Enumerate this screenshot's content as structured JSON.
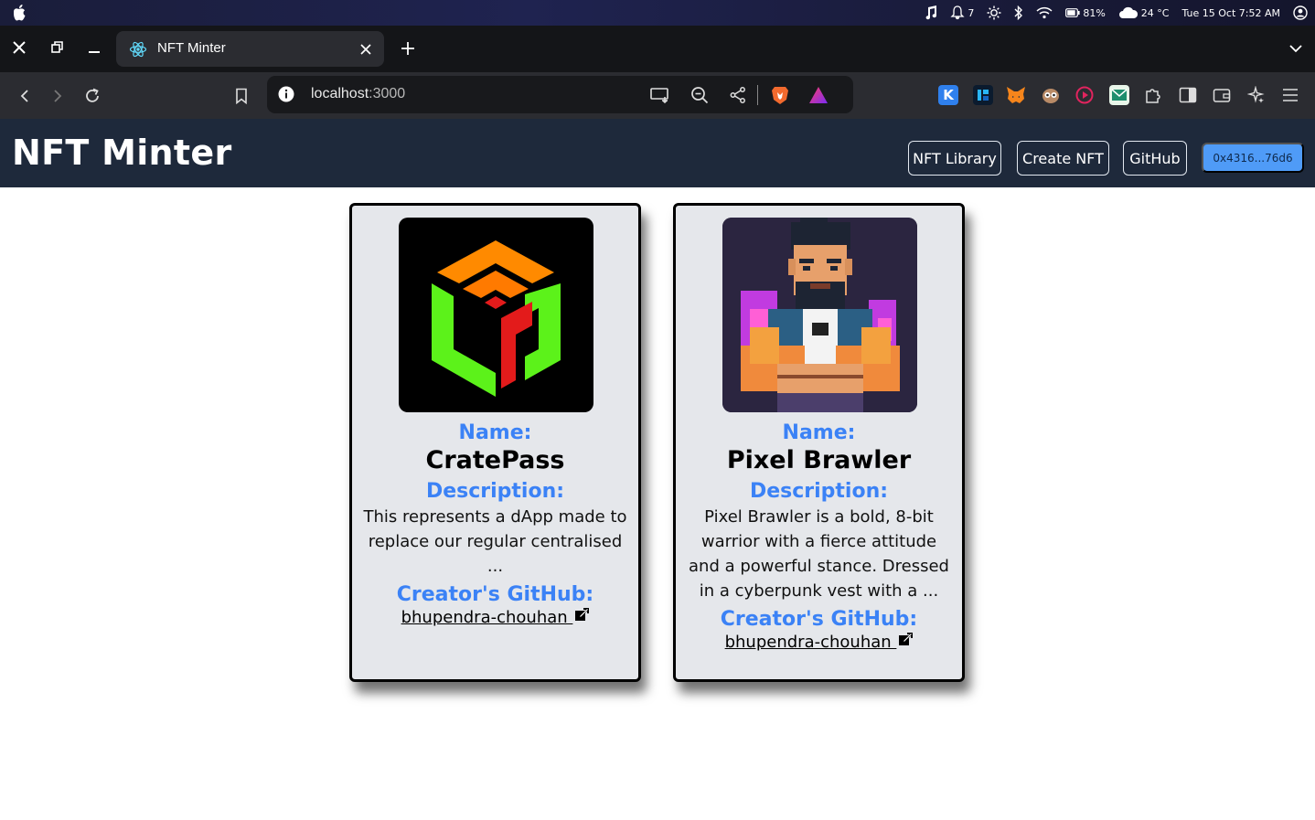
{
  "os": {
    "battery": "81%",
    "weather": "24 °C",
    "datetime": "Tue 15 Oct  7:52 AM",
    "notifications": "7"
  },
  "browser": {
    "tab_title": "NFT Minter",
    "url_host": "localhost",
    "url_port": ":3000"
  },
  "app": {
    "title": "NFT Minter",
    "nav": {
      "library": "NFT Library",
      "create": "Create NFT",
      "github": "GitHub"
    },
    "wallet": "0x4316...76d6"
  },
  "labels": {
    "name": "Name:",
    "description": "Description:",
    "creator": "Creator's GitHub:"
  },
  "cards": [
    {
      "name": "CratePass",
      "description_lines": [
        "This represents a dApp made to",
        "replace our regular centralised",
        "..."
      ],
      "creator": "bhupendra-chouhan "
    },
    {
      "name": "Pixel Brawler",
      "description_lines": [
        "Pixel Brawler is a bold, 8-bit",
        "warrior with a fierce attitude",
        "and a powerful stance. Dressed",
        "in a cyberpunk vest with a ..."
      ],
      "creator": "bhupendra-chouhan "
    }
  ]
}
